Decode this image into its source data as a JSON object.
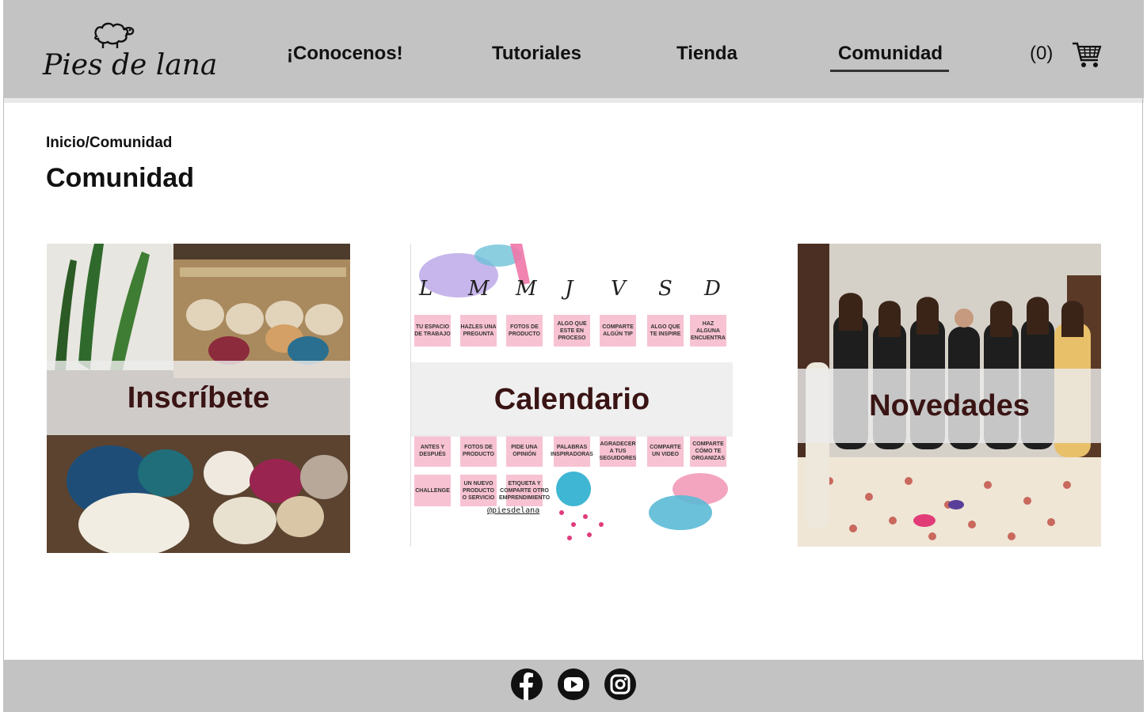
{
  "brand": {
    "name": "Pies de lana",
    "logo_icon": "sheep-icon"
  },
  "nav": {
    "items": [
      {
        "label": "¡Conocenos!"
      },
      {
        "label": "Tutoriales"
      },
      {
        "label": "Tienda"
      },
      {
        "label": "Comunidad",
        "active": true
      }
    ],
    "cart_count": "(0)",
    "cart_icon": "shopping-cart-icon"
  },
  "breadcrumb": "Inicio/Comunidad",
  "page_title": "Comunidad",
  "cards": [
    {
      "label": "Inscríbete",
      "image": "yarn-skeins-photo"
    },
    {
      "label": "Calendario",
      "image": "content-calendar-graphic"
    },
    {
      "label": "Novedades",
      "image": "community-group-photo"
    }
  ],
  "calendar": {
    "days": [
      "L",
      "M",
      "M",
      "J",
      "V",
      "S",
      "D"
    ],
    "row1": [
      "TU ESPACIO DE TRABAJO",
      "HAZLES UNA PREGUNTA",
      "FOTOS DE PRODUCTO",
      "ALGO QUE ESTE EN PROCESO",
      "COMPARTE ALGÚN TIP",
      "ALGO QUE TE INSPIRE",
      "HAZ ALGUNA ENCUENTRA"
    ],
    "row4": [
      "ANTES Y DESPUÉS",
      "FOTOS DE PRODUCTO",
      "PIDE UNA OPINIÓN",
      "PALABRAS INSPIRADORAS",
      "AGRADECER A TUS SEGUIDORES",
      "COMPARTE UN VIDEO",
      "COMPARTE CÓMO TE ORGANIZAS"
    ],
    "row5": [
      "CHALLENGE",
      "UN NUEVO PRODUCTO O SERVICIO",
      "ETIQUETA Y COMPARTE OTRO EMPRENDIMIENTO"
    ],
    "handle": "@piesdelana"
  },
  "footer": {
    "social": [
      {
        "name": "facebook-icon"
      },
      {
        "name": "youtube-icon"
      },
      {
        "name": "instagram-icon"
      }
    ]
  },
  "colors": {
    "header_bg": "#c3c3c3",
    "card_label": "#3a1414",
    "calendar_pink": "#f7c2d2"
  }
}
